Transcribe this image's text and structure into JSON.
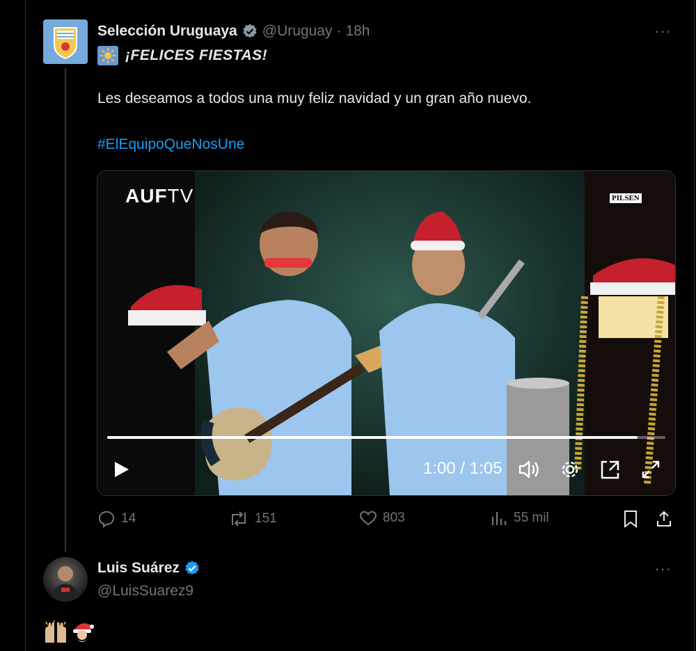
{
  "tweet": {
    "author_name": "Selección Uruguaya",
    "author_handle": "@Uruguay",
    "separator": "·",
    "time": "18h",
    "more": "···",
    "greeting": "¡FELICES FIESTAS!",
    "body": "Les deseamos a todos una muy feliz navidad y un gran año nuevo.",
    "hashtag": "#ElEquipoQueNosUne",
    "video": {
      "logo_main": "AUF",
      "logo_suffix": "TV",
      "sponsor": "PILSEN",
      "time_display": "1:00 / 1:05",
      "progress": 0.95
    },
    "actions": {
      "replies": "14",
      "reposts": "151",
      "likes": "803",
      "views": "55 mil"
    }
  },
  "reply": {
    "author_name": "Luis Suárez",
    "author_handle": "@LuisSuarez9",
    "more": "···",
    "emojis": [
      "raising-hands",
      "santa-claus"
    ]
  },
  "colors": {
    "background": "#000000",
    "text": "#e7e9ea",
    "secondary": "#71767b",
    "link": "#1d9bf0",
    "verified": "#1d9bf0",
    "uruguay_blue": "#75aadb"
  }
}
